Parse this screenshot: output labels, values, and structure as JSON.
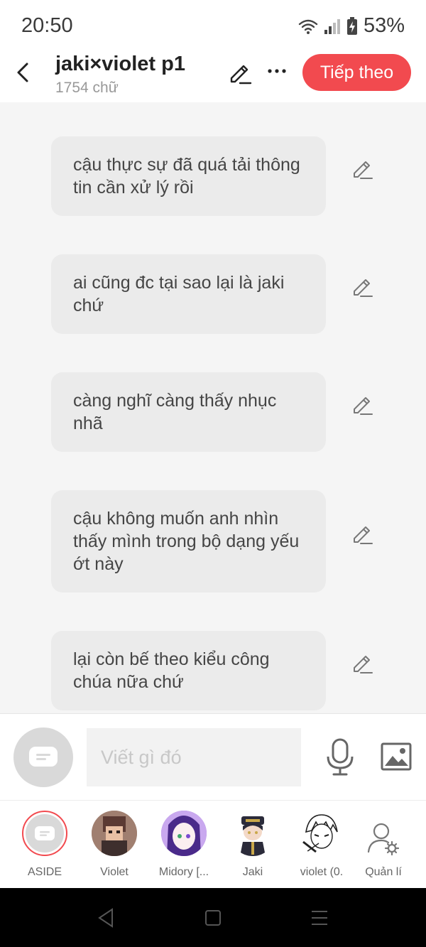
{
  "status_bar": {
    "time": "20:50",
    "battery": "53%"
  },
  "header": {
    "title": "jaki×violet p1",
    "word_count": "1754 chữ",
    "next_label": "Tiếp theo",
    "icons": {
      "back": "chevron-left-icon",
      "edit": "pencil-icon",
      "more": "more-horizontal-icon"
    }
  },
  "messages": [
    {
      "text": "cậu thực sự đã quá tải thông tin cần xử lý rồi"
    },
    {
      "text": "ai cũng đc tại sao lại là jaki chứ"
    },
    {
      "text": "càng nghĩ càng thấy nhục nhã"
    },
    {
      "text": "cậu không muốn anh nhìn thấy mình trong bộ dạng yếu ớt này"
    },
    {
      "text": "lại còn bế theo kiểu công chúa nữa chứ"
    }
  ],
  "composer": {
    "placeholder": "Viết gì đó",
    "icons": {
      "aside": "chat-bubble-icon",
      "mic": "microphone-icon",
      "image": "image-icon"
    }
  },
  "characters": [
    {
      "label": "ASIDE",
      "selected": true
    },
    {
      "label": "Violet"
    },
    {
      "label": "Midory [..."
    },
    {
      "label": "Jaki"
    },
    {
      "label": "violet (0."
    },
    {
      "label": "Quản lí"
    }
  ],
  "colors": {
    "accent": "#f24a4f",
    "bubble": "#ebebeb",
    "content_bg": "#f5f5f5"
  }
}
